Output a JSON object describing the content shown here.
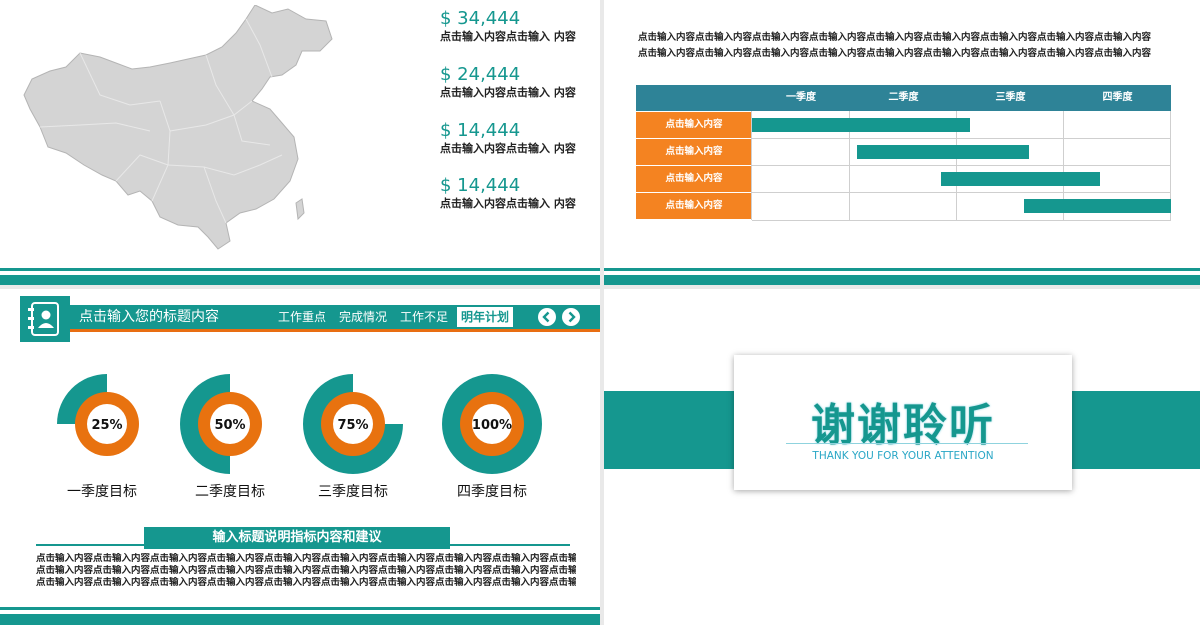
{
  "colors": {
    "teal": "#15978f",
    "orange": "#f48321",
    "header_blue": "#2e8397"
  },
  "slide1": {
    "stats": [
      {
        "value": "$ 34,444",
        "text": "点击输入内容点击输入 内容"
      },
      {
        "value": "$ 24,444",
        "text": "点击输入内容点击输入 内容"
      },
      {
        "value": "$ 14,444",
        "text": "点击输入内容点击输入 内容"
      },
      {
        "value": "$ 14,444",
        "text": "点击输入内容点击输入 内容"
      }
    ]
  },
  "slide2": {
    "paragraph": [
      "点击输入内容点击输入内容点击输入内容点击输入内容点击输入内容点击输入内容点击输入内容点击输入内容点击输入内容",
      "点击输入内容点击输入内容点击输入内容点击输入内容点击输入内容点击输入内容点击输入内容点击输入内容点击输入内容"
    ],
    "columns": [
      "一季度",
      "二季度",
      "三季度",
      "四季度"
    ],
    "rows": [
      {
        "label": "点击输入内容",
        "start": 0.0,
        "end": 0.52
      },
      {
        "label": "点击输入内容",
        "start": 0.25,
        "end": 0.66
      },
      {
        "label": "点击输入内容",
        "start": 0.45,
        "end": 0.83
      },
      {
        "label": "点击输入内容",
        "start": 0.65,
        "end": 1.0
      }
    ]
  },
  "slide3": {
    "title": "点击输入您的标题内容",
    "nav": [
      "工作重点",
      "完成情况",
      "工作不足",
      "明年计划"
    ],
    "donuts": [
      {
        "percent": "25%",
        "value": 25,
        "label": "一季度目标"
      },
      {
        "percent": "50%",
        "value": 50,
        "label": "二季度目标"
      },
      {
        "percent": "75%",
        "value": 75,
        "label": "三季度目标"
      },
      {
        "percent": "100%",
        "value": 100,
        "label": "四季度目标"
      }
    ],
    "subtitle": "输入标题说明指标内容和建议",
    "body": [
      "点击输入内容点击输入内容点击输入内容点击输入内容点击输入内容点击输入内容点击输入内容点击输入内容点击输入内容点击输入内容",
      "点击输入内容点击输入内容点击输入内容点击输入内容点击输入内容点击输入内容点击输入内容点击输入内容点击输入内容点击输入内容",
      "点击输入内容点击输入内容点击输入内容点击输入内容点击输入内容点击输入内容点击输入内容点击输入内容点击输入内容点击输入内容"
    ]
  },
  "slide4": {
    "thanks": "谢谢聆听",
    "subtitle": "THANK YOU FOR YOUR ATTENTION"
  }
}
